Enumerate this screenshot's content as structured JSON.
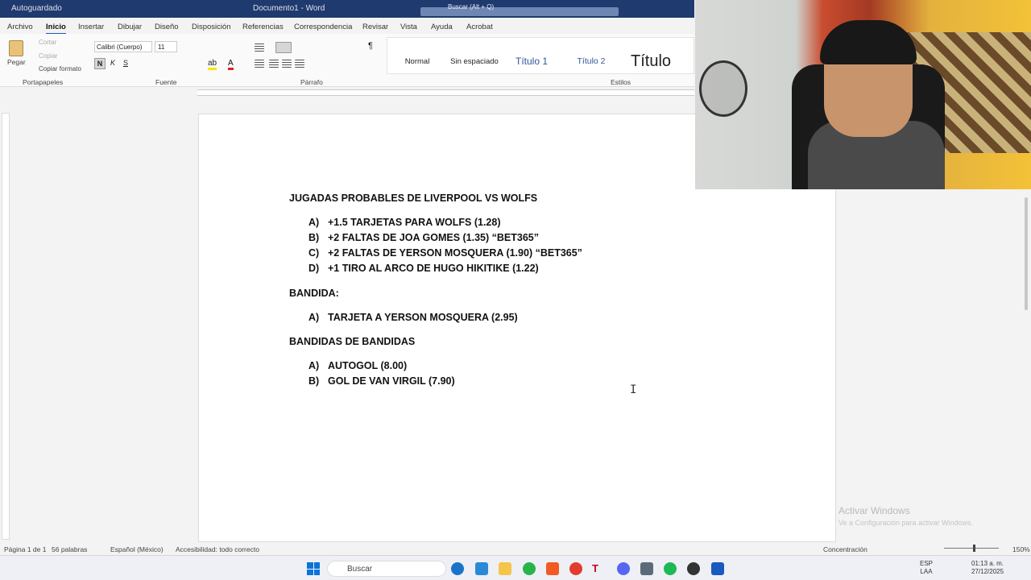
{
  "titlebar": {
    "autosave": "Autoguardado",
    "document_title": "Documento1 - Word",
    "search_placeholder": "Buscar (Alt + Q)"
  },
  "tabs": [
    "Archivo",
    "Inicio",
    "Insertar",
    "Dibujar",
    "Diseño",
    "Disposición",
    "Referencias",
    "Correspondencia",
    "Revisar",
    "Vista",
    "Ayuda",
    "Acrobat"
  ],
  "active_tab": "Inicio",
  "ribbon": {
    "clipboard": {
      "paste": "Pegar",
      "cut": "Cortar",
      "copy": "Copiar",
      "format_painter": "Copiar formato",
      "label": "Portapapeles"
    },
    "font": {
      "name": "Calibri (Cuerpo)",
      "size": "11",
      "label": "Fuente"
    },
    "paragraph": {
      "label": "Párrafo"
    },
    "styles": {
      "items": [
        "Normal",
        "Sin espaciado",
        "Título 1",
        "Título 2",
        "Título"
      ],
      "label": "Estilos"
    }
  },
  "document": {
    "heading1": "JUGADAS PROBABLES DE LIVERPOOL VS WOLFS",
    "list1": [
      {
        "marker": "A)",
        "text": "+1.5 TARJETAS PARA WOLFS (1.28)"
      },
      {
        "marker": "B)",
        "text": "+2 FALTAS DE JOA GOMES (1.35) “BET365”"
      },
      {
        "marker": "C)",
        "text": "+2 FALTAS DE YERSON MOSQUERA (1.90) “BET365”"
      },
      {
        "marker": "D)",
        "text": "+1 TIRO AL ARCO DE HUGO HIKITIKE (1.22)"
      }
    ],
    "heading2": "BANDIDA:",
    "list2": [
      {
        "marker": "A)",
        "text": "TARJETA A YERSON MOSQUERA (2.95)"
      }
    ],
    "heading3": "BANDIDAS DE BANDIDAS",
    "list3": [
      {
        "marker": "A)",
        "text": "AUTOGOL (8.00)"
      },
      {
        "marker": "B)",
        "text": "GOL DE VAN VIRGIL (7.90)"
      }
    ]
  },
  "watermark": {
    "line1": "Activar Windows",
    "line2": "Ve a Configuración para activar Windows."
  },
  "statusbar": {
    "page": "Página 1 de 1",
    "words": "56 palabras",
    "language": "Español (México)",
    "accessibility": "Accesibilidad: todo correcto",
    "focus": "Concentración",
    "zoom": "150%"
  },
  "taskbar": {
    "search": "Buscar",
    "lang": "ESP",
    "lang2": "LAA",
    "time": "01:13 a. m.",
    "date": "27/12/2025"
  },
  "colors": {
    "accent": "#185abd",
    "titlebar": "#1f3a6e"
  }
}
